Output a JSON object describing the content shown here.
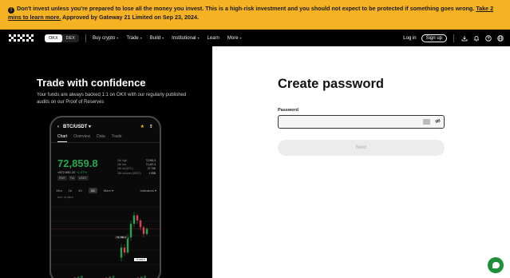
{
  "banner": {
    "warn_icon": "!",
    "text": "Don't invest unless you're prepared to lose all the money you invest. This is a high-risk investment and you should not expect to be protected if something goes wrong.",
    "link": "Take 2 mins to learn more.",
    "approval": "Approved by Gateway 21 Limited on Sep 23, 2024.",
    "bg_color": "#f5b324"
  },
  "nav": {
    "seg_active": "OKX",
    "seg_inactive": "DEX",
    "items": [
      {
        "label": "Buy crypto",
        "caret": "▾"
      },
      {
        "label": "Trade",
        "caret": "▾"
      },
      {
        "label": "Build",
        "caret": "▾"
      },
      {
        "label": "Institutional",
        "caret": "▾"
      },
      {
        "label": "Learn",
        "caret": ""
      },
      {
        "label": "More",
        "caret": "▾"
      }
    ],
    "login": "Log in",
    "signup": "Sign up",
    "icons": [
      "download-icon",
      "bell-icon",
      "help-icon",
      "globe-icon"
    ]
  },
  "promo": {
    "title": "Trade with confidence",
    "subtitle": "Your funds are always backed 1:1 on OKX with our regularly published audits on our Proof of Reserves"
  },
  "phone": {
    "pair": "BTC/USDT ▾",
    "tabs": [
      "Chart",
      "Overview",
      "Data",
      "Trade"
    ],
    "price": "72,859.8",
    "sub_price": "≈$72,880.20",
    "change": "+1.97%",
    "badges": [
      "RWT",
      "Tkr",
      "USDT"
    ],
    "stats": [
      {
        "k": "24h high",
        "v": "72,916.3"
      },
      {
        "k": "24h low",
        "v": "71,447.4"
      },
      {
        "k": "24h vol (BTC)",
        "v": "27.74K"
      },
      {
        "k": "24h turnover (USDT)",
        "v": "1.99B"
      }
    ],
    "intervals": [
      "15m",
      "1h",
      "4h",
      "1D",
      "More ▾"
    ],
    "indicators": "Indicators ▾",
    "ma": "MA7: 72,768.5",
    "tag_top": "72,780.4",
    "tag_mid": "72,859.8",
    "candles": [
      {
        "o": 71500,
        "c": 71800,
        "h": 71900,
        "l": 71400
      },
      {
        "o": 71800,
        "c": 71650,
        "h": 71900,
        "l": 71550
      },
      {
        "o": 71650,
        "c": 72100,
        "h": 72200,
        "l": 71600
      },
      {
        "o": 72100,
        "c": 72500,
        "h": 72600,
        "l": 72000
      },
      {
        "o": 72500,
        "c": 72750,
        "h": 72850,
        "l": 72400
      },
      {
        "o": 72750,
        "c": 72600,
        "h": 72800,
        "l": 72500
      },
      {
        "o": 72600,
        "c": 72400,
        "h": 72650,
        "l": 72300
      },
      {
        "o": 72400,
        "c": 72200,
        "h": 72450,
        "l": 72100
      },
      {
        "o": 72200,
        "c": 72350,
        "h": 72400,
        "l": 72150
      }
    ]
  },
  "form": {
    "title": "Create password",
    "label": "Password",
    "placeholder": "",
    "next": "Next"
  },
  "chat": {
    "icon": "chat-icon",
    "color": "#1f8f3a"
  }
}
